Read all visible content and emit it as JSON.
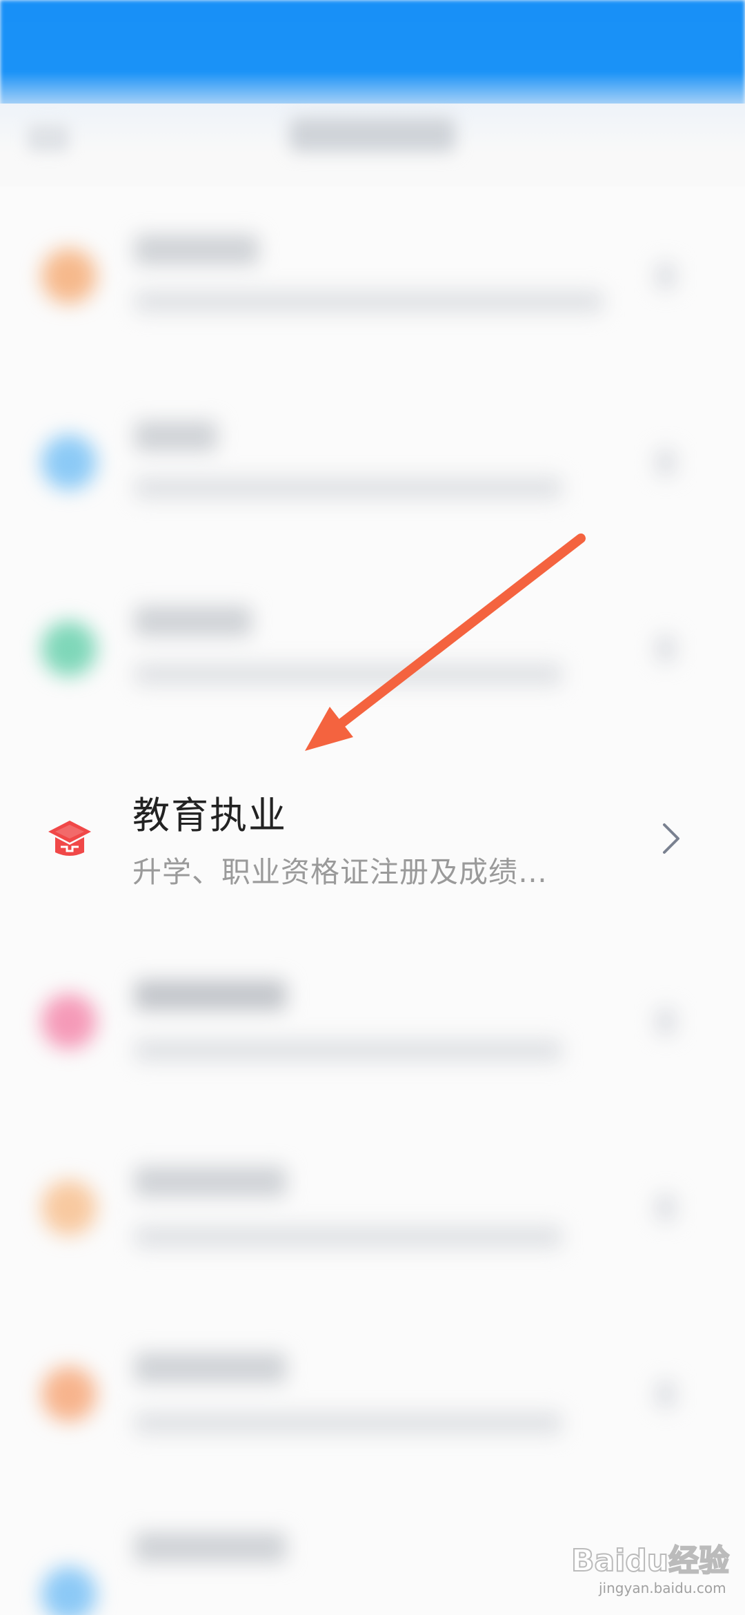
{
  "app": {
    "status_bar_color": "#1890f7"
  },
  "main": {
    "highlighted_item": {
      "title": "教育执业",
      "subtitle": "升学、职业资格证注册及成绩…",
      "icon": "graduation-cap-icon",
      "icon_color": "#f04848"
    },
    "blurred_item_icon_colors": [
      "#f6b98c",
      "#8ccaf6",
      "#7fd7b9",
      "#f59ab8",
      "#f8c9a0",
      "#f7b48d",
      "#8cc9f6"
    ]
  },
  "annotation": {
    "arrow_color": "#f4633f"
  },
  "watermark": {
    "brand": "Baidu经验",
    "url": "jingyan.baidu.com"
  }
}
